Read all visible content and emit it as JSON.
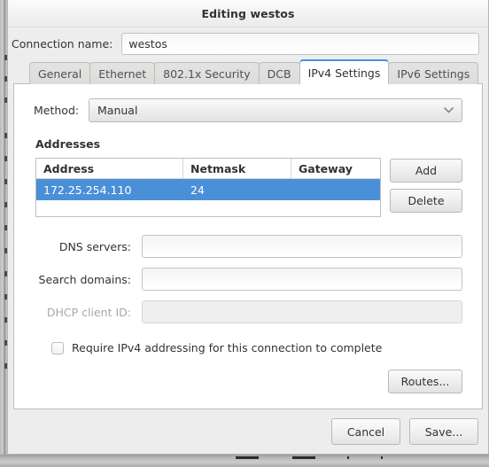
{
  "window": {
    "title": "Editing westos"
  },
  "connection": {
    "name_label": "Connection name:",
    "name_value": "westos",
    "name_placeholder": ""
  },
  "tabs": [
    {
      "label": "General",
      "active": false
    },
    {
      "label": "Ethernet",
      "active": false
    },
    {
      "label": "802.1x Security",
      "active": false
    },
    {
      "label": "DCB",
      "active": false
    },
    {
      "label": "IPv4 Settings",
      "active": true
    },
    {
      "label": "IPv6 Settings",
      "active": false
    }
  ],
  "ipv4": {
    "method_label": "Method:",
    "method_value": "Manual",
    "method_icon": "chevron-down-icon",
    "addresses_title": "Addresses",
    "table": {
      "columns": [
        "Address",
        "Netmask",
        "Gateway"
      ],
      "rows": [
        {
          "address": "172.25.254.110",
          "netmask": "24",
          "gateway": "",
          "selected": true
        }
      ]
    },
    "add_label": "Add",
    "delete_label": "Delete",
    "dns_label": "DNS servers:",
    "dns_value": "",
    "search_label": "Search domains:",
    "search_value": "",
    "dhcp_label": "DHCP client ID:",
    "dhcp_value": "",
    "dhcp_disabled": true,
    "require_label": "Require IPv4 addressing for this connection to complete",
    "require_checked": false,
    "routes_label": "Routes..."
  },
  "actions": {
    "cancel_label": "Cancel",
    "save_label": "Save..."
  },
  "colors": {
    "accent": "#4a90d9",
    "selection_bg": "#4a90d9",
    "selection_text": "#ffffff",
    "dialog_bg": "#ededed",
    "panel_bg": "#ffffff",
    "text": "#2e3436",
    "disabled_text": "#a8a8a6",
    "border": "#bdbdba"
  }
}
